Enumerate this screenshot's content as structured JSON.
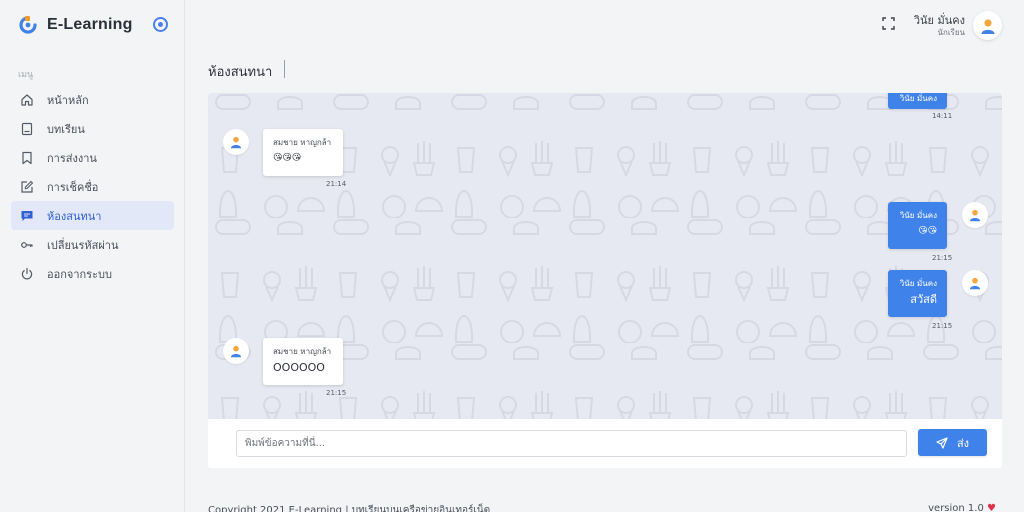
{
  "app": {
    "name": "E-Learning"
  },
  "sidebar": {
    "heading": "เมนู",
    "items": [
      {
        "label": "หน้าหลัก",
        "icon": "home-icon"
      },
      {
        "label": "บทเรียน",
        "icon": "book-icon"
      },
      {
        "label": "การส่งงาน",
        "icon": "bookmark-icon"
      },
      {
        "label": "การเช็คชื่อ",
        "icon": "edit-icon"
      },
      {
        "label": "ห้องสนทนา",
        "icon": "chat-icon",
        "active": true
      },
      {
        "label": "เปลี่ยนรหัสผ่าน",
        "icon": "key-icon"
      },
      {
        "label": "ออกจากระบบ",
        "icon": "power-icon"
      }
    ]
  },
  "header": {
    "user_name": "วินัย มั่นคง",
    "user_role": "นักเรียน"
  },
  "page": {
    "title": "ห้องสนทนา"
  },
  "chat": {
    "messages": [
      {
        "side": "out",
        "sender": "วินัย มั่นคง",
        "text": "",
        "time": "14:11"
      },
      {
        "side": "in",
        "sender": "สมชาย หาญกล้า",
        "text": "😘😘😘",
        "time": "21:14"
      },
      {
        "side": "out",
        "sender": "วินัย มั่นคง",
        "text": "😘😘",
        "time": "21:15"
      },
      {
        "side": "out",
        "sender": "วินัย มั่นคง",
        "text": "สวัสดี",
        "time": "21:15"
      },
      {
        "side": "in",
        "sender": "สมชาย หาญกล้า",
        "text": "OOOOOO",
        "time": "21:15"
      }
    ],
    "input_placeholder": "พิมพ์ข้อความที่นี่...",
    "send_label": "ส่ง"
  },
  "footer": {
    "copyright": "Copyright 2021 E-Learning | บทเรียนบนเครือข่ายอินเทอร์เน็ต",
    "version": "version 1.0"
  },
  "colors": {
    "accent": "#3f82ea",
    "active_bg": "#e2e8f7",
    "chat_bg": "#e7e9f2"
  }
}
